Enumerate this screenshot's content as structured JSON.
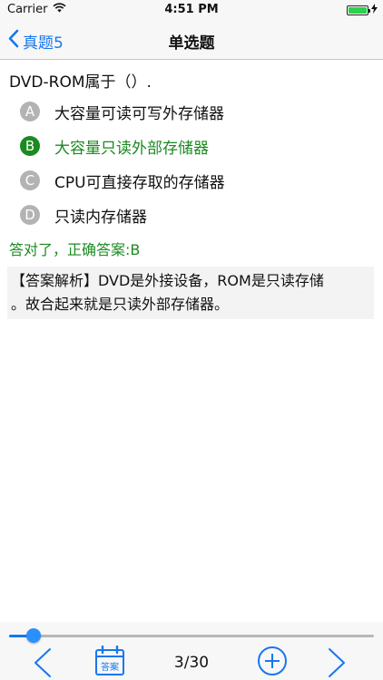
{
  "status": {
    "carrier": "Carrier",
    "time": "4:51 PM",
    "battery_level": 1.0
  },
  "nav": {
    "back_label": "真题5",
    "title": "单选题"
  },
  "question": {
    "text": "DVD-ROM属于（）."
  },
  "options": [
    {
      "letter": "A",
      "text": "大容量可读可写外存储器",
      "correct": false
    },
    {
      "letter": "B",
      "text": "大容量只读外部存储器",
      "correct": true
    },
    {
      "letter": "C",
      "text": "CPU可直接存取的存储器",
      "correct": false
    },
    {
      "letter": "D",
      "text": "只读内存储器",
      "correct": false
    }
  ],
  "result_text": "答对了，正确答案:B",
  "analysis": {
    "line1": "【答案解析】DVD是外接设备，ROM是只读存储",
    "line2": "。故合起来就是只读外部存储器。"
  },
  "progress": {
    "current": 3,
    "total": 30,
    "fraction": 0.0667
  },
  "toolbar": {
    "answer_label": "答案",
    "page_label": "3/30"
  },
  "colors": {
    "accent": "#1777f0",
    "correct": "#1b8a21",
    "badge_gray": "#b3b3b3"
  }
}
